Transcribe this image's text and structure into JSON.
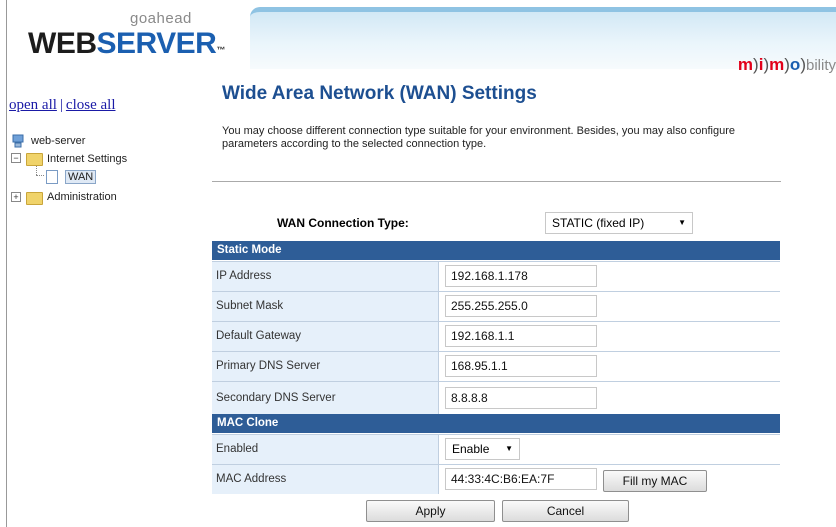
{
  "header": {
    "logo_small": "goahead",
    "logo_web": "WEB",
    "logo_server": "SERVER",
    "logo_tm": "™",
    "brand": {
      "part1": "m",
      "part2": ")",
      "part3": "i",
      "part4": ")",
      "part5": "m",
      "part6": ")",
      "part7": "o",
      "part8": ")",
      "part9": "bility"
    }
  },
  "tree": {
    "open_all": "open all",
    "separator": "|",
    "close_all": "close all",
    "root": "web-server",
    "internet_settings": "Internet Settings",
    "wan": "WAN",
    "administration": "Administration"
  },
  "main": {
    "title": "Wide Area Network (WAN) Settings",
    "description": "You may choose different connection type suitable for your environment. Besides, you may also configure parameters according to the selected connection type.",
    "conn_type_label": "WAN Connection Type:",
    "conn_type_value": "STATIC (fixed IP)",
    "static_section": "Static Mode",
    "static_rows": [
      {
        "label": "IP Address",
        "value": "192.168.1.178"
      },
      {
        "label": "Subnet Mask",
        "value": "255.255.255.0"
      },
      {
        "label": "Default Gateway",
        "value": "192.168.1.1"
      },
      {
        "label": "Primary DNS Server",
        "value": "168.95.1.1"
      },
      {
        "label": "Secondary DNS Server",
        "value": "8.8.8.8"
      }
    ],
    "mac_section": "MAC Clone",
    "enabled_label": "Enabled",
    "enabled_value": "Enable",
    "mac_label": "MAC Address",
    "mac_value": "44:33:4C:B6:EA:7F",
    "fill_mac": "Fill my MAC",
    "apply": "Apply",
    "cancel": "Cancel"
  }
}
